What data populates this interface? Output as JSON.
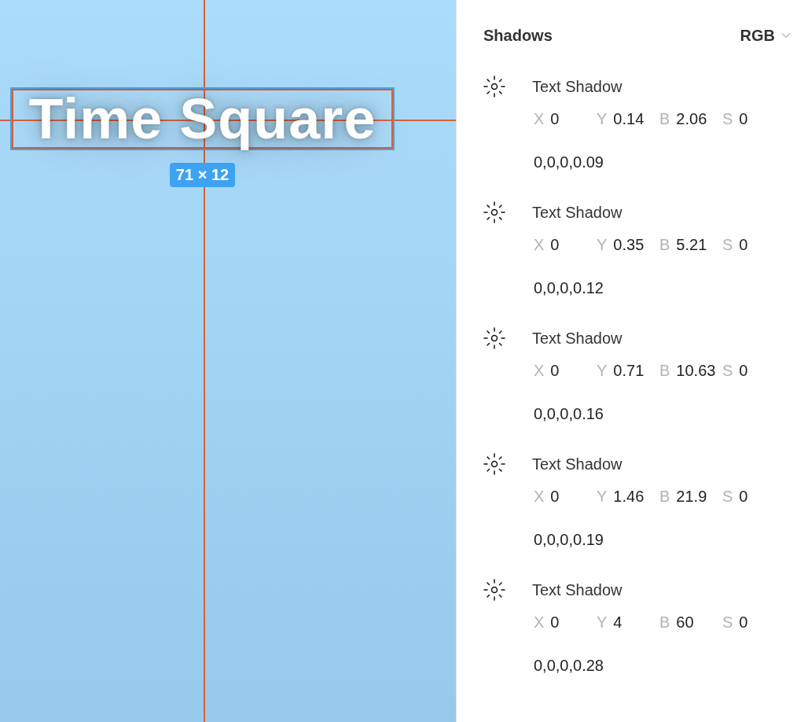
{
  "canvas": {
    "text": "Time Square",
    "size_badge": "71 × 12"
  },
  "panel": {
    "title": "Shadows",
    "color_mode": "RGB",
    "shadows": [
      {
        "type": "Text Shadow",
        "params": [
          {
            "axis": "X",
            "value": "0"
          },
          {
            "axis": "Y",
            "value": "0.14"
          },
          {
            "axis": "B",
            "value": "2.06"
          },
          {
            "axis": "S",
            "value": "0"
          }
        ],
        "rgba": "0,0,0,0.09"
      },
      {
        "type": "Text Shadow",
        "params": [
          {
            "axis": "X",
            "value": "0"
          },
          {
            "axis": "Y",
            "value": "0.35"
          },
          {
            "axis": "B",
            "value": "5.21"
          },
          {
            "axis": "S",
            "value": "0"
          }
        ],
        "rgba": "0,0,0,0.12"
      },
      {
        "type": "Text Shadow",
        "params": [
          {
            "axis": "X",
            "value": "0"
          },
          {
            "axis": "Y",
            "value": "0.71"
          },
          {
            "axis": "B",
            "value": "10.63"
          },
          {
            "axis": "S",
            "value": "0"
          }
        ],
        "rgba": "0,0,0,0.16"
      },
      {
        "type": "Text Shadow",
        "params": [
          {
            "axis": "X",
            "value": "0"
          },
          {
            "axis": "Y",
            "value": "1.46"
          },
          {
            "axis": "B",
            "value": "21.9"
          },
          {
            "axis": "S",
            "value": "0"
          }
        ],
        "rgba": "0,0,0,0.19"
      },
      {
        "type": "Text Shadow",
        "params": [
          {
            "axis": "X",
            "value": "0"
          },
          {
            "axis": "Y",
            "value": "4"
          },
          {
            "axis": "B",
            "value": "60"
          },
          {
            "axis": "S",
            "value": "0"
          }
        ],
        "rgba": "0,0,0,0.28"
      }
    ]
  }
}
